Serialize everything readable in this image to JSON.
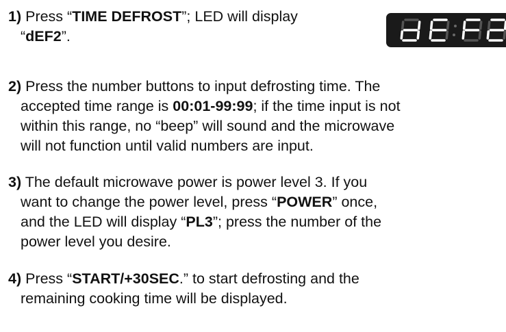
{
  "step1": {
    "num": "1)",
    "t1": " Press “",
    "k1": "TIME DEFROST",
    "t2": "”; LED will display",
    "t3": "“",
    "k2": "dEF2",
    "t4": "”."
  },
  "led_display": {
    "text": "dEF2",
    "segment_color": "#ffffff",
    "background_color": "#1a1a1a"
  },
  "step2": {
    "num": "2)",
    "l1": " Press the number buttons to input defrosting time. The",
    "l2a": "accepted time range is ",
    "l2k": "00:01-99:99",
    "l2b": "; if the time input is not",
    "l3": "within this range, no “beep” will sound and the microwave",
    "l4": "will not function until valid numbers are input."
  },
  "step3": {
    "num": "3)",
    "l1": " The default microwave power is power level 3. If you",
    "l2a": "want to change the power level, press “",
    "l2k": "POWER",
    "l2b": "” once,",
    "l3a": "and the LED will display “",
    "l3k": "PL3",
    "l3b": "”; press the number of the",
    "l4": "power level you desire."
  },
  "step4": {
    "num": "4)",
    "l1a": " Press “",
    "l1k": "START/+30SEC",
    "l1b": ".” to start defrosting and the",
    "l2": "remaining cooking time will be displayed."
  }
}
